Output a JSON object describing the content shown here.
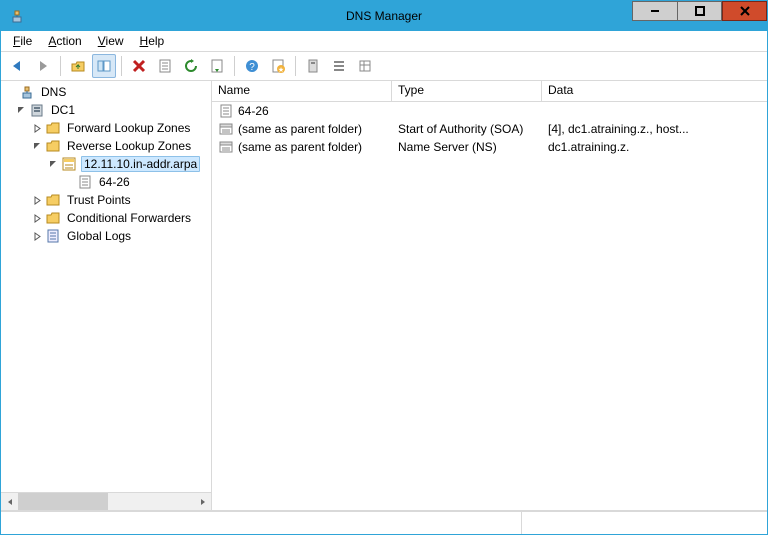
{
  "window": {
    "title": "DNS Manager"
  },
  "menubar": {
    "items": [
      {
        "label": "File",
        "under": "F"
      },
      {
        "label": "Action",
        "under": "A"
      },
      {
        "label": "View",
        "under": "V"
      },
      {
        "label": "Help",
        "under": "H"
      }
    ]
  },
  "tree": {
    "root_label": "DNS",
    "nodes": {
      "dc1": "DC1",
      "flz": "Forward Lookup Zones",
      "rlz": "Reverse Lookup Zones",
      "zone": "12.11.10.in-addr.arpa",
      "sub": "64-26",
      "tp": "Trust Points",
      "cf": "Conditional Forwarders",
      "gl": "Global Logs"
    }
  },
  "list": {
    "columns": {
      "name": "Name",
      "type": "Type",
      "data": "Data"
    },
    "col_widths": {
      "name": 180,
      "type": 150,
      "data": 220
    },
    "rows": [
      {
        "icon": "file",
        "name": "64-26",
        "type": "",
        "data": ""
      },
      {
        "icon": "record",
        "name": "(same as parent folder)",
        "type": "Start of Authority (SOA)",
        "data": "[4], dc1.atraining.z., host..."
      },
      {
        "icon": "record",
        "name": "(same as parent folder)",
        "type": "Name Server (NS)",
        "data": "dc1.atraining.z."
      }
    ]
  }
}
